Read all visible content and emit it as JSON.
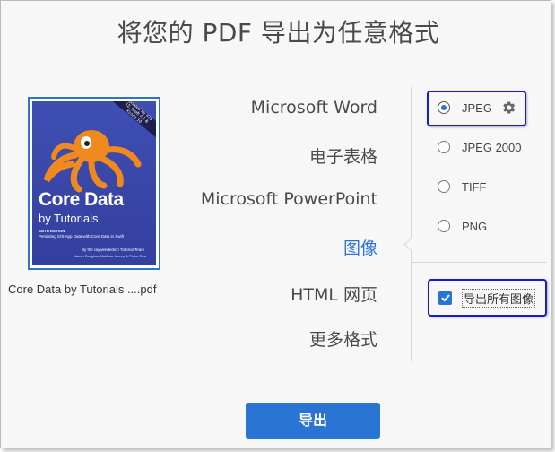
{
  "title": "将您的 PDF 导出为任意格式",
  "file": {
    "name": "Core Data by Tutorials ....pdf",
    "cover": {
      "title": "Core Data",
      "subtitle": "by Tutorials",
      "edition": "SIXTH EDITION",
      "description": "Persisting iOS App Data with Core Data in Swift",
      "team": "By the raywenderlich Tutorial Team",
      "authors": "Aaron Douglas, Matthew Morey & Pietro Rea",
      "ribbon": "Updated for iOS 12, Swift 4.2 & Xcode 10"
    }
  },
  "formats": [
    {
      "label": "Microsoft Word",
      "active": false
    },
    {
      "label": "电子表格",
      "active": false
    },
    {
      "label": "Microsoft PowerPoint",
      "active": false
    },
    {
      "label": "图像",
      "active": true
    },
    {
      "label": "HTML 网页",
      "active": false
    },
    {
      "label": "更多格式",
      "active": false
    }
  ],
  "image_options": [
    {
      "label": "JPEG",
      "selected": true,
      "settings_icon": "gear-icon"
    },
    {
      "label": "JPEG 2000",
      "selected": false
    },
    {
      "label": "TIFF",
      "selected": false
    },
    {
      "label": "PNG",
      "selected": false
    }
  ],
  "export_all_images": {
    "label": "导出所有图像",
    "checked": true
  },
  "export_button": "导出",
  "colors": {
    "accent": "#2a74d4",
    "highlight": "#1a1acc",
    "background": "#f7f7f7"
  }
}
